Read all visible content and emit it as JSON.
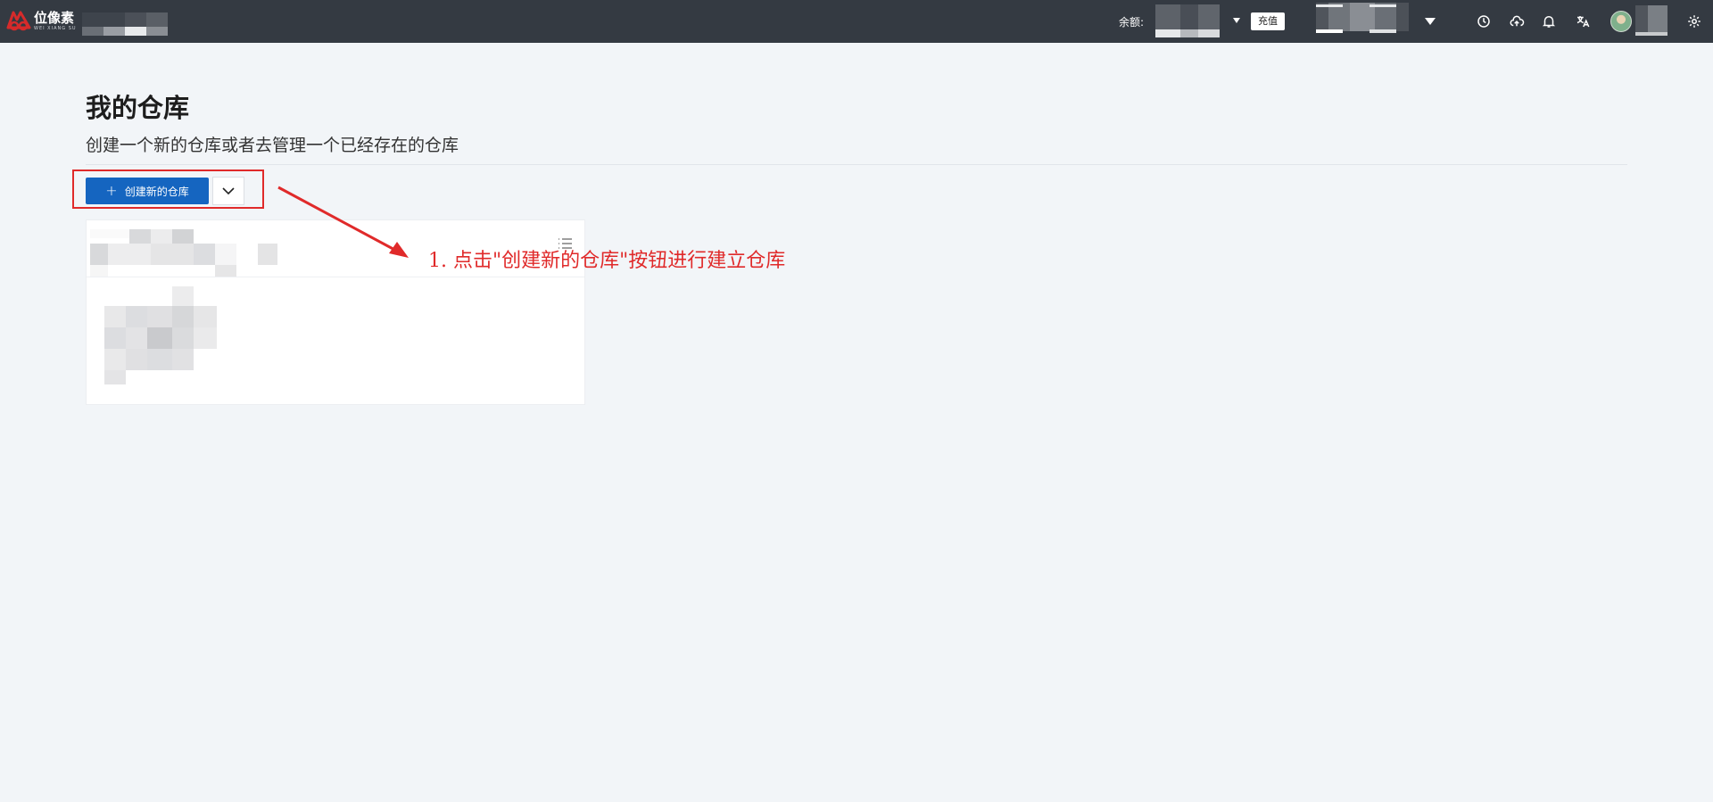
{
  "header": {
    "logo": {
      "text_cn": "位像素",
      "text_en": "WEI XIANG SU"
    },
    "balance_label": "余额:",
    "recharge_label": "充值",
    "icons": [
      "history-icon",
      "cloud-upload-icon",
      "bell-icon",
      "translate-icon",
      "avatar",
      "settings-icon"
    ]
  },
  "page": {
    "title": "我的仓库",
    "subtitle": "创建一个新的仓库或者去管理一个已经存在的仓库",
    "create_button_label": "创建新的仓库"
  },
  "annotation": {
    "text": "1. 点击\"创建新的仓库\"按钮进行建立仓库",
    "color": "#e02a2a"
  },
  "colors": {
    "topbar": "#343a42",
    "primary": "#1565c0",
    "background": "#f2f5f8",
    "annotation": "#e02a2a"
  }
}
